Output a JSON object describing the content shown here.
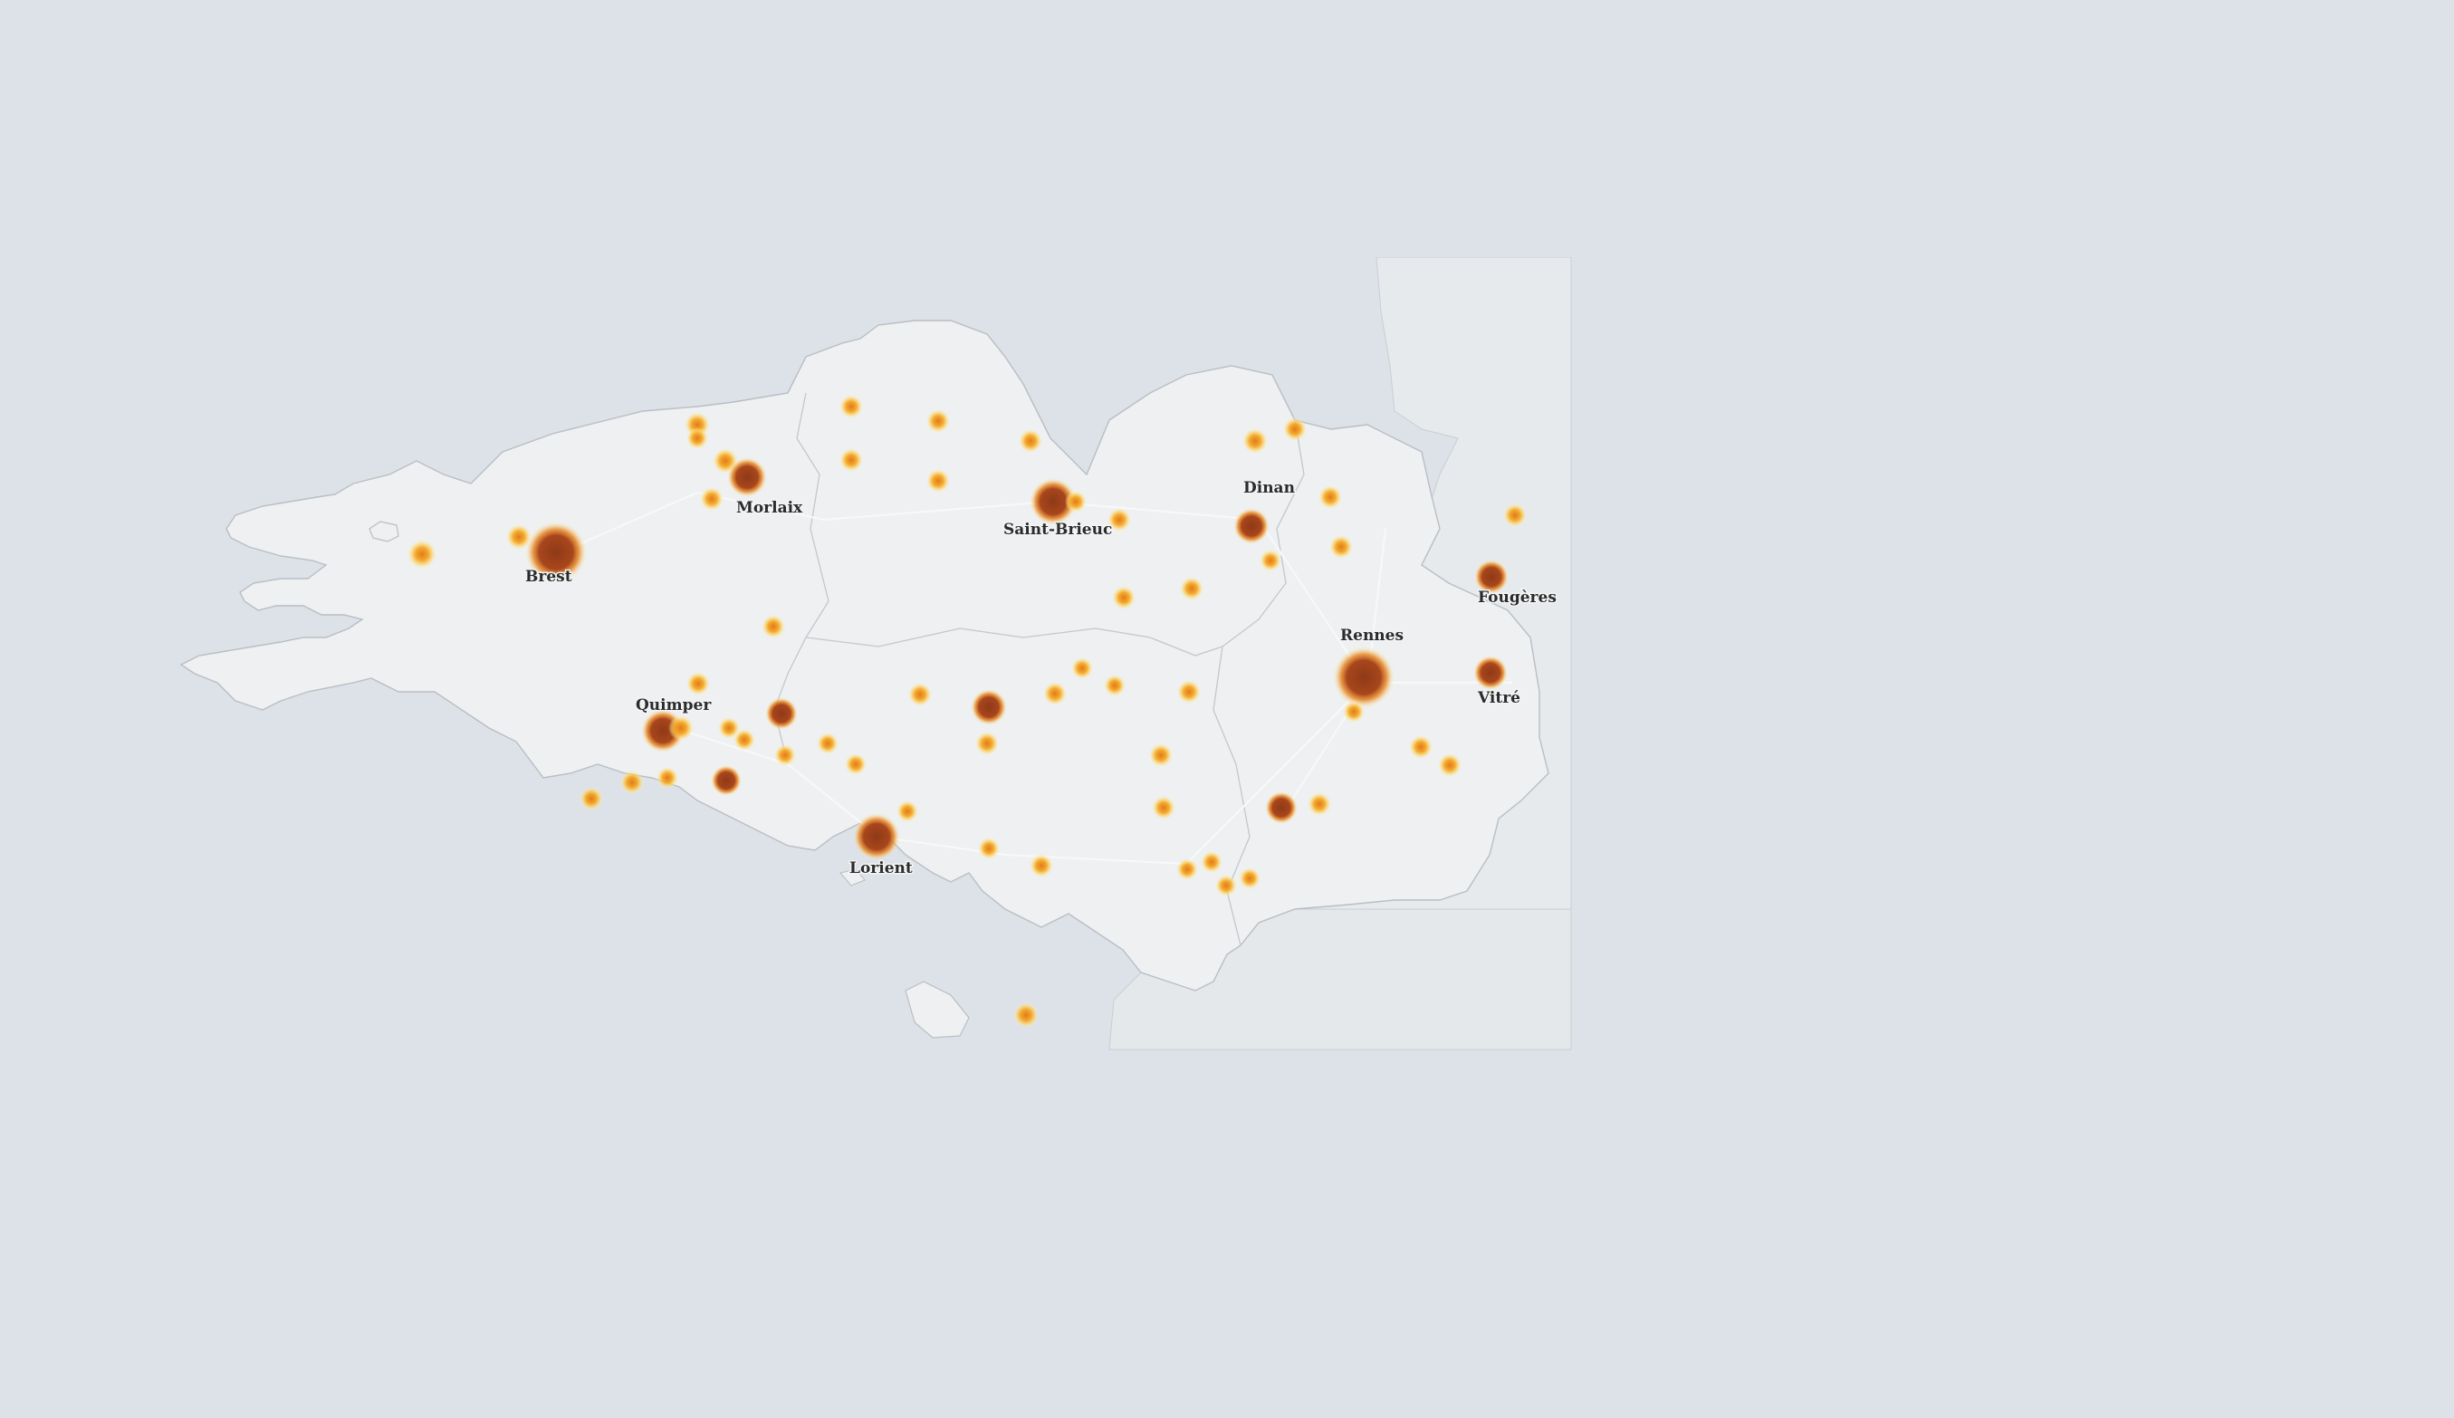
{
  "map": {
    "region": "Bretagne",
    "colors": {
      "sea": "#dde2e8",
      "land": "#eef0f1",
      "neighbor_land": "#e7eaec",
      "border": "#b9bec4",
      "heat_low": "#fff2b0",
      "heat_mid": "#f5a623",
      "heat_high": "#a0411a"
    },
    "labels": [
      {
        "name": "Brest"
      },
      {
        "name": "Morlaix"
      },
      {
        "name": "Saint-Brieuc"
      },
      {
        "name": "Dinan"
      },
      {
        "name": "Rennes"
      },
      {
        "name": "Fougères"
      },
      {
        "name": "Vitré"
      },
      {
        "name": "Quimper"
      },
      {
        "name": "Lorient"
      }
    ],
    "hotspot_count": 62
  }
}
